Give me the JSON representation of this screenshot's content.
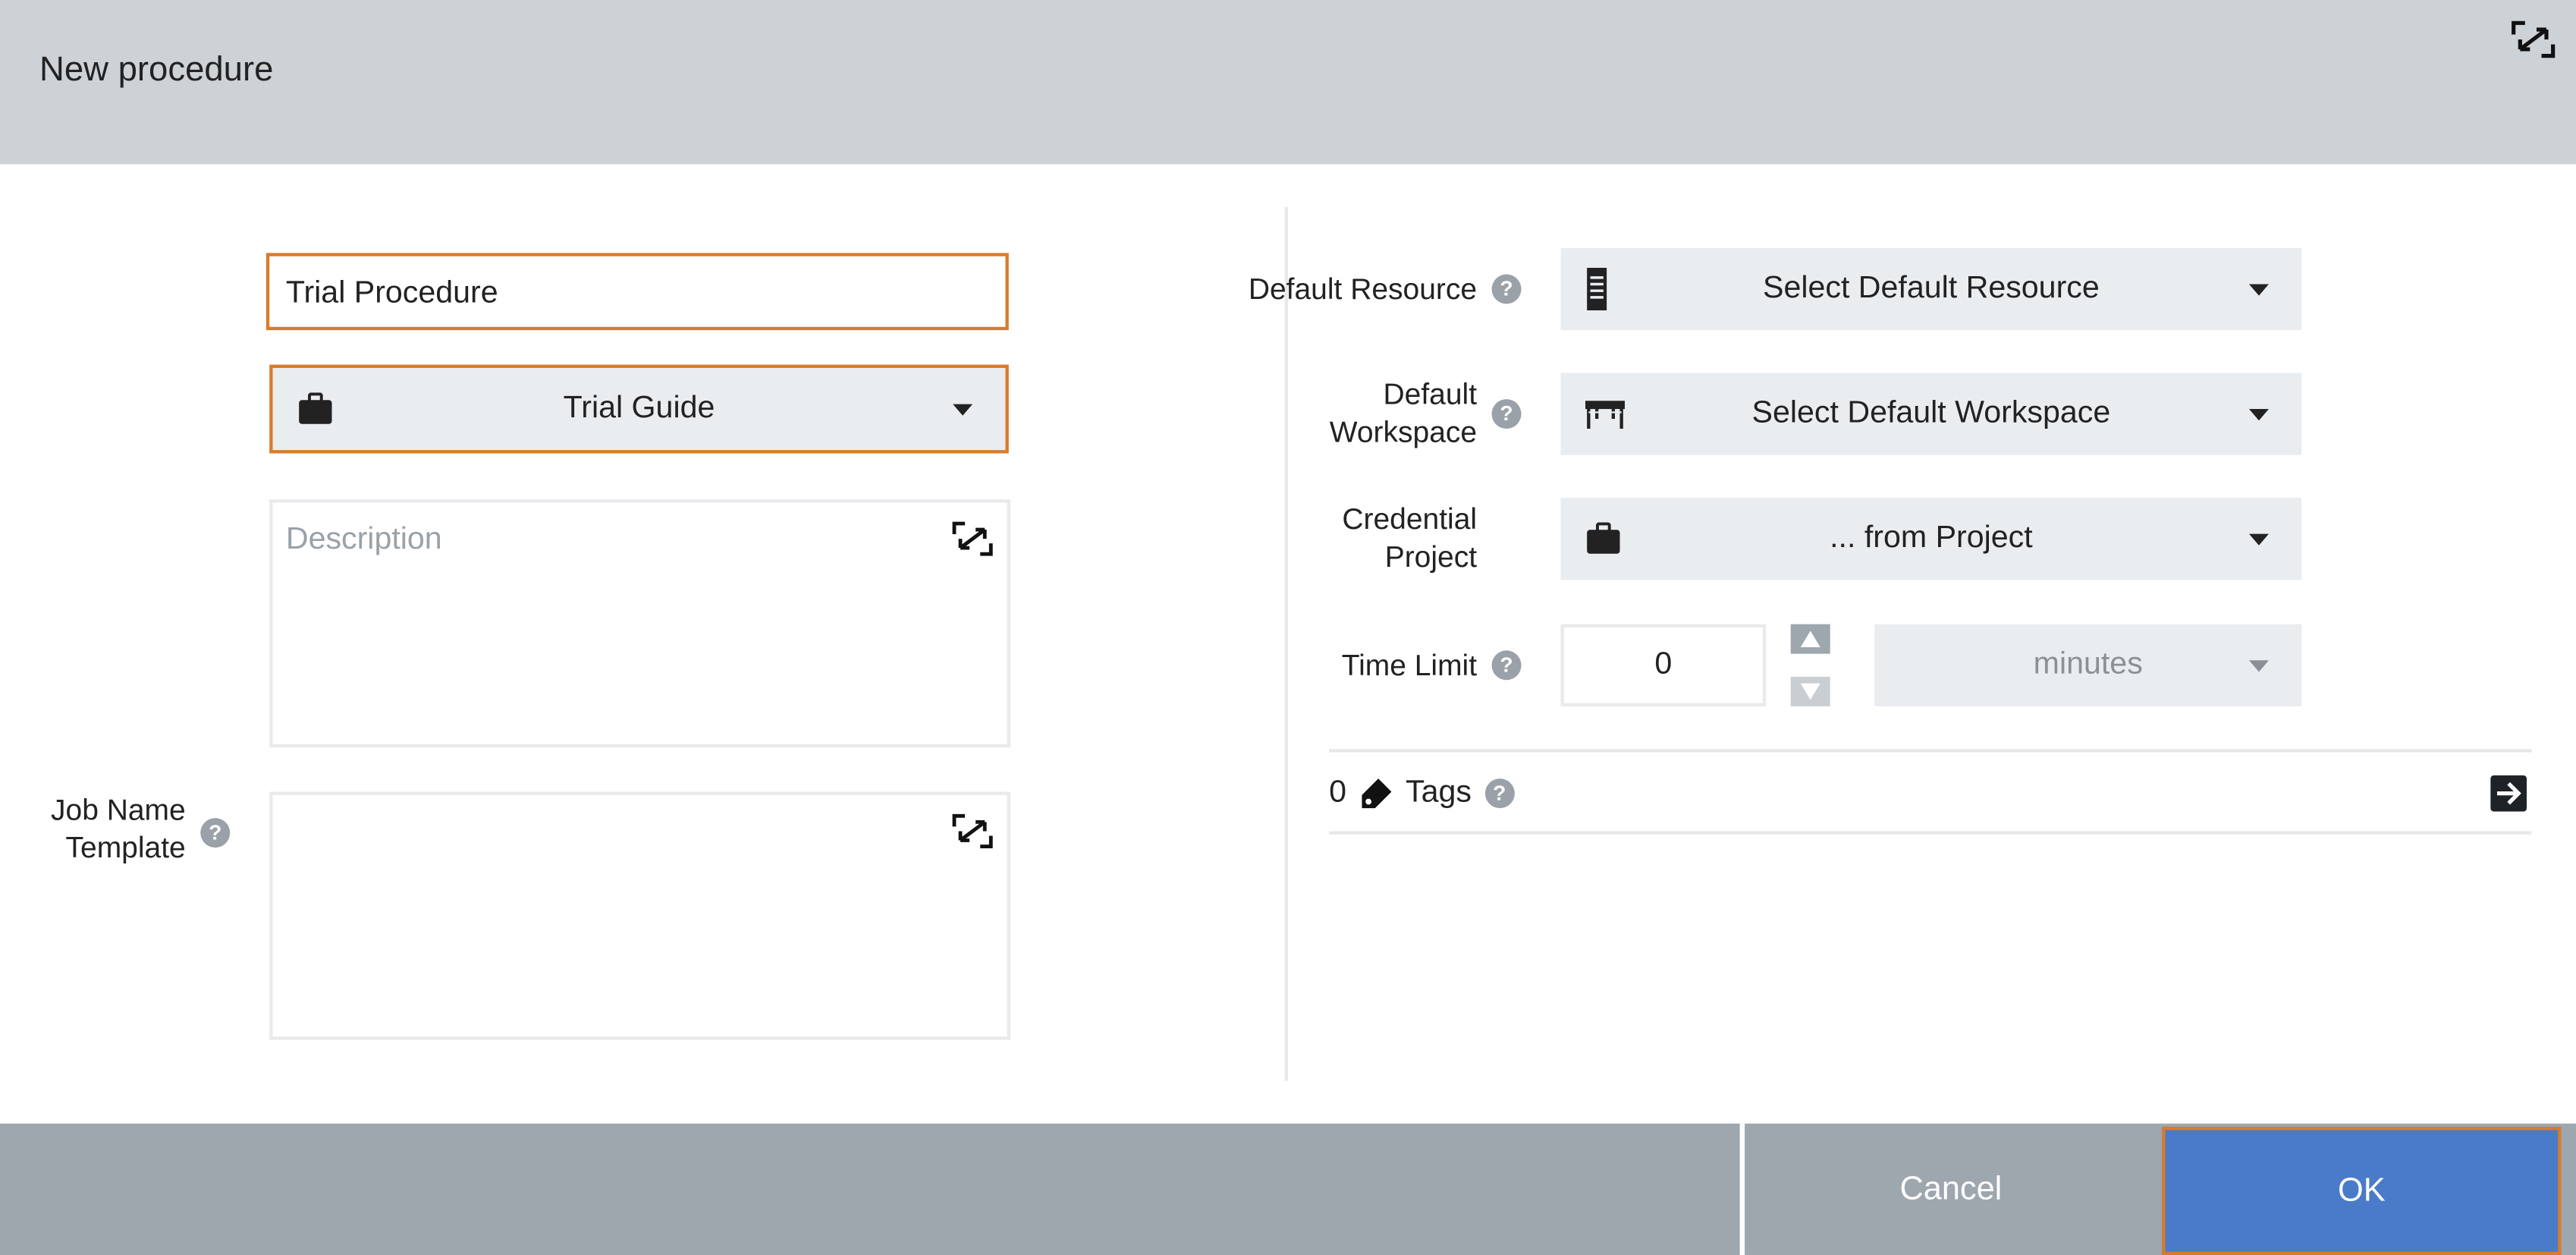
{
  "dialog": {
    "title": "New procedure"
  },
  "left": {
    "name_value": "Trial Procedure",
    "guide_value": "Trial Guide",
    "description_placeholder": "Description",
    "job_name_label": "Job Name Template"
  },
  "right": {
    "default_resource_label": "Default Resource",
    "default_resource_value": "Select Default Resource",
    "default_workspace_label": "Default Workspace",
    "default_workspace_value": "Select Default Workspace",
    "credential_label": "Credential Project",
    "credential_value": "... from Project",
    "time_limit_label": "Time Limit",
    "time_limit_value": "0",
    "time_unit": "minutes",
    "tags_count": "0",
    "tags_label": "Tags"
  },
  "footer": {
    "cancel_label": "Cancel",
    "ok_label": "OK"
  },
  "colors": {
    "focus_border": "#d97b2b",
    "ok_button": "#4a7bc8",
    "header": "#cdd2d6",
    "footer": "#9ea6ae"
  }
}
